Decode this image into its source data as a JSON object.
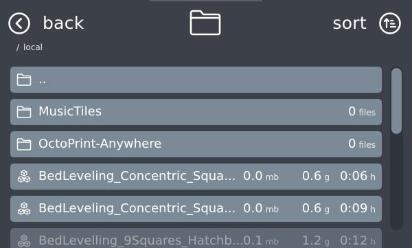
{
  "header": {
    "back_label": "back",
    "sort_label": "sort",
    "back_icon": "arrow-left-circle-icon",
    "folder_icon": "folder-icon",
    "sort_icon": "sort-ascending-circle-icon"
  },
  "breadcrumb": {
    "separator": "/",
    "path": "local"
  },
  "files": [
    {
      "type": "folder",
      "icon": "folder-icon",
      "name": "..",
      "count": "",
      "count_unit": ""
    },
    {
      "type": "folder",
      "icon": "folder-icon",
      "name": "MusicTiles",
      "count": "0",
      "count_unit": "files"
    },
    {
      "type": "folder",
      "icon": "folder-icon",
      "name": "OctoPrint-Anywhere",
      "count": "0",
      "count_unit": "files"
    },
    {
      "type": "gcode",
      "icon": "cubes-icon",
      "name": "BedLeveling_Concentric_Squa...",
      "size": "0.0",
      "size_unit": "mb",
      "weight": "0.6",
      "weight_unit": "g",
      "time": "0:06",
      "time_unit": "h"
    },
    {
      "type": "gcode",
      "icon": "cubes-icon",
      "name": "BedLeveling_Concentric_Squa...",
      "size": "0.0",
      "size_unit": "mb",
      "weight": "0.6",
      "weight_unit": "g",
      "time": "0:09",
      "time_unit": "h"
    },
    {
      "type": "gcode",
      "icon": "cubes-icon",
      "name": "BedLevelling_9Squares_Hatchb...",
      "size": "0.1",
      "size_unit": "mb",
      "weight": "1.2",
      "weight_unit": "g",
      "time": "0:12",
      "time_unit": "h"
    }
  ],
  "colors": {
    "background": "#3c4049",
    "row": "#7c8996",
    "text": "#ffffff"
  }
}
